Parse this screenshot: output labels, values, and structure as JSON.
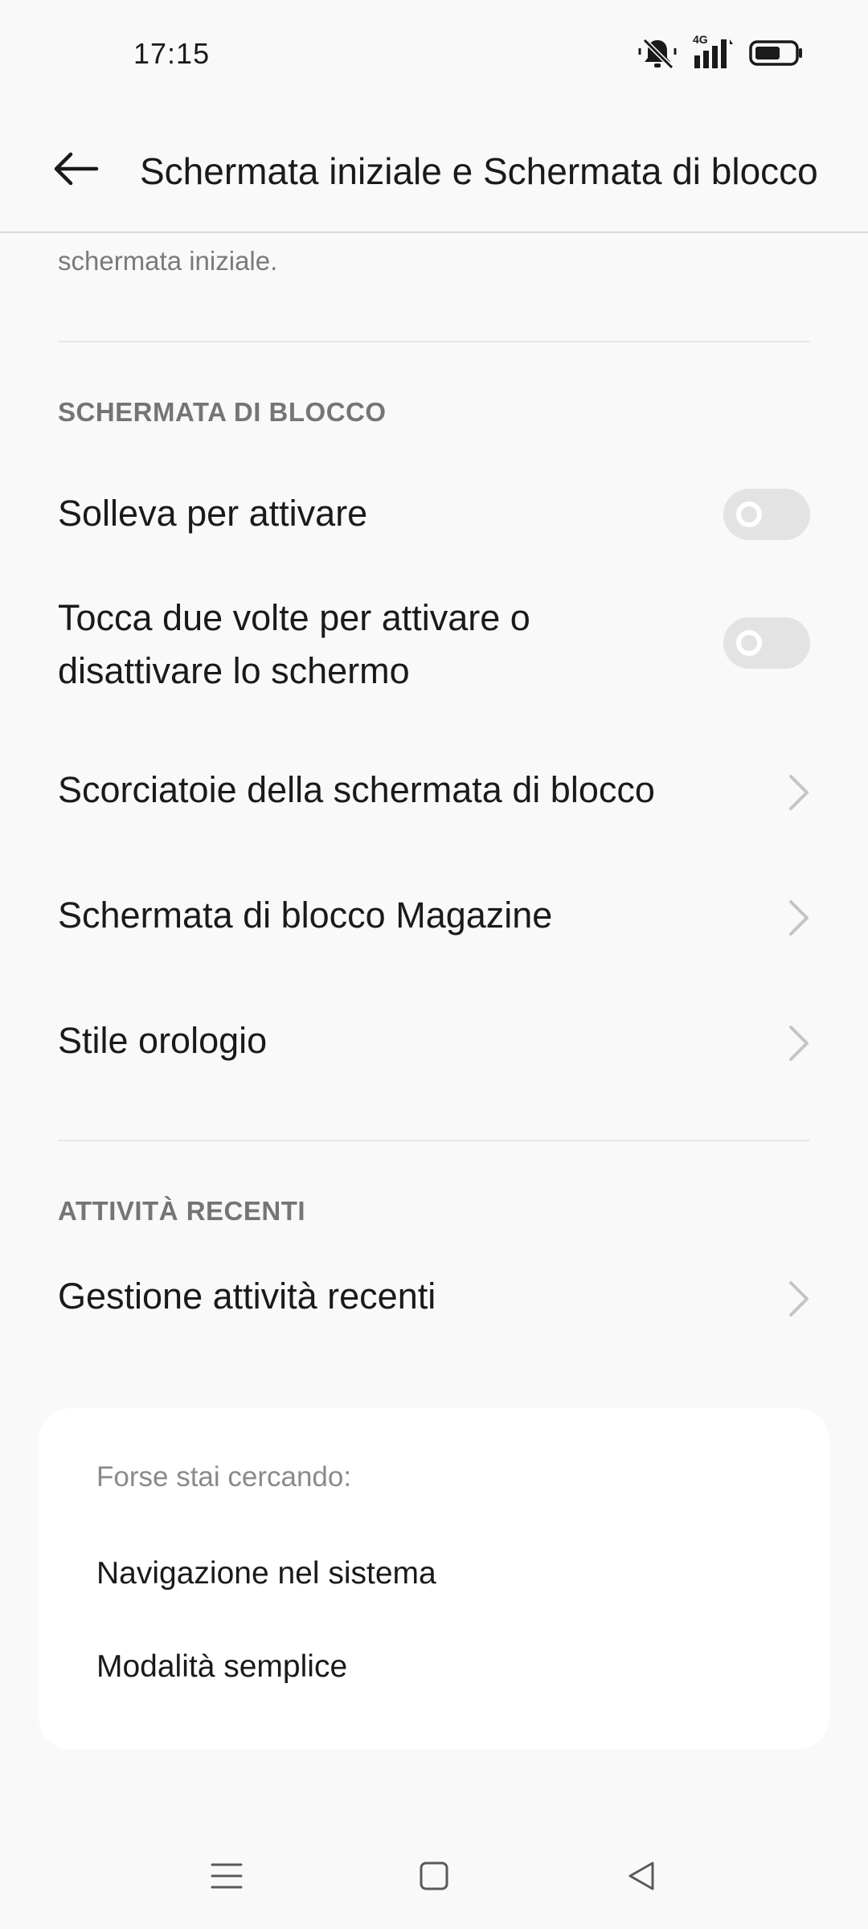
{
  "status_bar": {
    "time": "17:15",
    "icons": [
      "bell-muted-icon",
      "signal-4g-icon",
      "battery-icon"
    ],
    "network_label": "4G"
  },
  "app_bar": {
    "back_icon": "arrow-left-icon",
    "title": "Schermata iniziale e Schermata di blocco"
  },
  "previous_item": {
    "description_tail": "schermata iniziale."
  },
  "lock_screen_section": {
    "header": "SCHERMATA DI BLOCCO",
    "items": [
      {
        "label": "Solleva per attivare",
        "type": "toggle",
        "enabled": false
      },
      {
        "label_line1": "Tocca due volte per attivare o",
        "label_line2": "disattivare lo schermo",
        "type": "toggle",
        "enabled": false
      },
      {
        "label": "Scorciatoie della schermata di blocco",
        "type": "link"
      },
      {
        "label": "Schermata di blocco Magazine",
        "type": "link"
      },
      {
        "label": "Stile orologio",
        "type": "link"
      }
    ]
  },
  "recent_section": {
    "header": "ATTIVITÀ RECENTI",
    "items": [
      {
        "label": "Gestione attività recenti",
        "type": "link"
      }
    ]
  },
  "suggestions": {
    "title": "Forse stai cercando:",
    "links": [
      "Navigazione nel sistema",
      "Modalità semplice"
    ]
  },
  "nav_bar": {
    "buttons": [
      "menu-icon",
      "home-icon",
      "back-triangle-icon"
    ]
  },
  "colors": {
    "background": "#f9f9f9",
    "card": "#ffffff",
    "toggle_off": "#e3e3e3",
    "secondary_text": "#757575"
  }
}
